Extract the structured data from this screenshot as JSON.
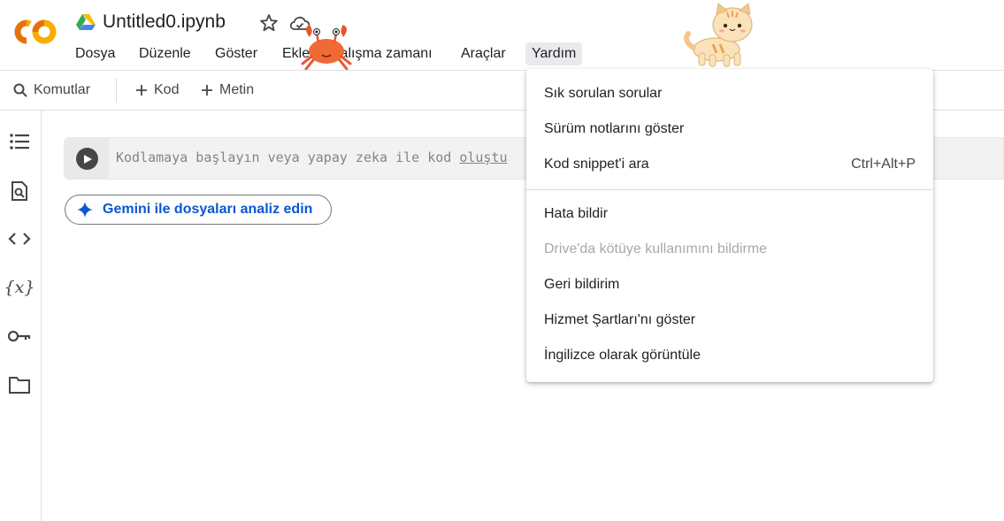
{
  "app": {
    "logo_text": "CO",
    "title": "Untitled0.ipynb"
  },
  "menu": {
    "items": [
      "Dosya",
      "Düzenle",
      "Göster",
      "Ekle",
      "Çalışma zamanı",
      "Araçlar",
      "Yardım"
    ],
    "active": "Yardım"
  },
  "toolbar": {
    "commands_label": "Komutlar",
    "add_code_label": "Kod",
    "add_text_label": "Metin"
  },
  "sidebar": {
    "icons": [
      "table-of-contents-icon",
      "find-icon",
      "code-snippets-icon",
      "variables-icon",
      "secrets-key-icon",
      "files-folder-icon"
    ],
    "variables_glyph": "{x}"
  },
  "cell": {
    "placeholder_prefix": "Kodlamaya başlayın veya yapay zeka ile kod ",
    "placeholder_link": "oluştu"
  },
  "gemini_button": {
    "label": "Gemini ile dosyaları analiz edin"
  },
  "help_menu": {
    "items": [
      {
        "label": "Sık sorulan sorular",
        "shortcut": "",
        "disabled": false
      },
      {
        "label": "Sürüm notlarını göster",
        "shortcut": "",
        "disabled": false
      },
      {
        "label": "Kod snippet'i ara",
        "shortcut": "Ctrl+Alt+P",
        "disabled": false
      },
      {
        "label": "Hata bildir",
        "shortcut": "",
        "disabled": false
      },
      {
        "label": "Drive'da kötüye kullanımını bildirme",
        "shortcut": "",
        "disabled": true
      },
      {
        "label": "Geri bildirim",
        "shortcut": "",
        "disabled": false
      },
      {
        "label": "Hizmet Şartları'nı göster",
        "shortcut": "",
        "disabled": false
      },
      {
        "label": "İngilizce olarak görüntüle",
        "shortcut": "",
        "disabled": false
      }
    ]
  },
  "colors": {
    "logo_orange": "#f9ab00",
    "logo_dark_orange": "#e8710a",
    "link_blue": "#0b57d0",
    "active_menu_bg": "#e8eaed"
  }
}
